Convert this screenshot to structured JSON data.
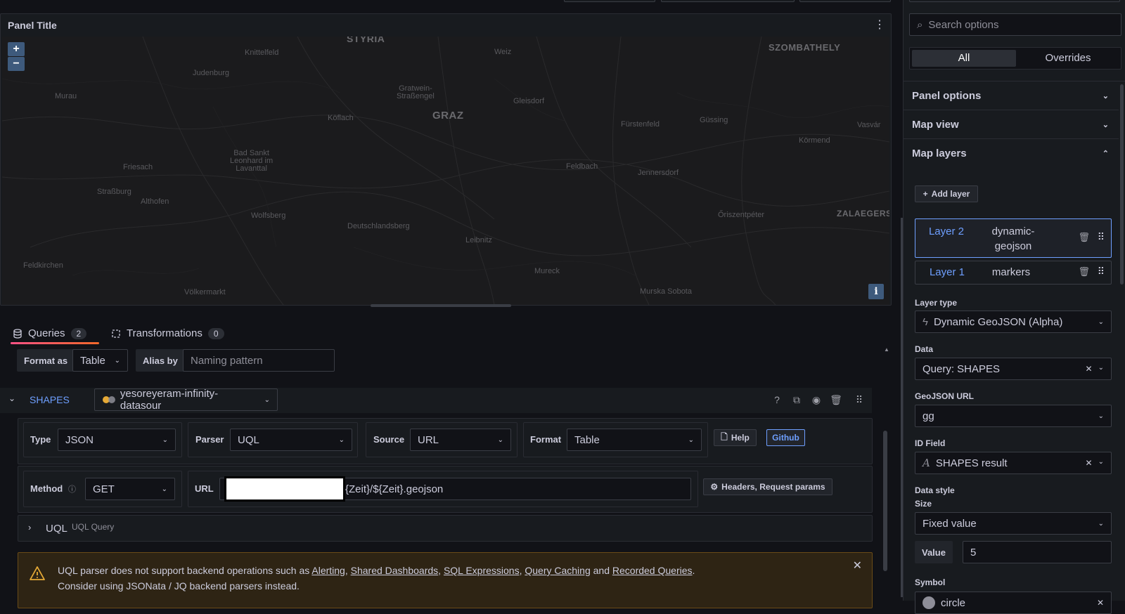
{
  "panel": {
    "title": "Panel Title",
    "menu_glyph": "⋮",
    "zoom_in": "+",
    "zoom_out": "−",
    "info_glyph": "i",
    "map_labels": {
      "styria": "STYRIA",
      "szombathely": "SZOMBATHELY",
      "knittelfeld": "Knittelfeld",
      "weiz": "Weiz",
      "judenburg": "Judenburg",
      "murau": "Murau",
      "gratwein": "Gratwein-\nStraßengel",
      "gleisdorf": "Gleisdorf",
      "graz": "GRAZ",
      "koflach": "Köflach",
      "furstenfeld": "Fürstenfeld",
      "gussing": "Güssing",
      "vasvar": "Vasvár",
      "kormend": "Körmend",
      "badsankt": "Bad Sankt\nLeonhard im\nLavanttal",
      "friesach": "Friesach",
      "feldbach": "Feldbach",
      "jennersdorf": "Jennersdorf",
      "strassburg": "Straßburg",
      "althofen": "Althofen",
      "wolfsberg": "Wolfsberg",
      "deutschlandsberg": "Deutschlandsberg",
      "oriszent": "Őriszentpéter",
      "zalaeg": "ZALAEGERSZ",
      "leibnitz": "Leibnitz",
      "feldkirchen": "Feldkirchen",
      "mureck": "Mureck",
      "volkermarkt": "Völkermarkt",
      "murska": "Murska Sobota"
    }
  },
  "tabs": {
    "queries_label": "Queries",
    "queries_count": "2",
    "transformations_label": "Transformations",
    "transformations_count": "0"
  },
  "query_options": {
    "format_as_label": "Format as",
    "format_as_value": "Table",
    "alias_by_label": "Alias by",
    "alias_placeholder": "Naming pattern"
  },
  "query": {
    "ref_id": "SHAPES",
    "datasource": "yesoreyeram-infinity-datasour",
    "type_label": "Type",
    "type_value": "JSON",
    "parser_label": "Parser",
    "parser_value": "UQL",
    "source_label": "Source",
    "source_value": "URL",
    "format_label": "Format",
    "format_value": "Table",
    "help_label": "Help",
    "github_label": "Github",
    "method_label": "Method",
    "method_value": "GET",
    "url_label": "URL",
    "url_value": "{Zeit}/${Zeit}.geojson",
    "headers_label": "Headers, Request params",
    "uql_title": "UQL",
    "uql_sub": "UQL Query"
  },
  "alert": {
    "line1_prefix": "UQL parser does not support backend operations such as ",
    "link_alerting": "Alerting",
    "sep1": ", ",
    "link_shared": "Shared Dashboards",
    "sep2": ", ",
    "link_sql": "SQL Expressions",
    "sep3": ", ",
    "link_caching": "Query Caching",
    "and_text": " and ",
    "link_recorded": "Recorded Queries",
    "end": ".",
    "line2": "Consider using JSONata / JQ backend parsers instead."
  },
  "options_pane": {
    "search_placeholder": "Search options",
    "tab_all": "All",
    "tab_overrides": "Overrides",
    "sections": {
      "panel_options": "Panel options",
      "map_view": "Map view",
      "map_layers": "Map layers"
    },
    "add_layer": "Add layer",
    "layers": [
      {
        "name": "Layer 2",
        "type": "dynamic-geojson"
      },
      {
        "name": "Layer 1",
        "type": "markers"
      }
    ],
    "layer_type_label": "Layer type",
    "layer_type_value": "Dynamic GeoJSON (Alpha)",
    "data_label": "Data",
    "data_value": "Query: SHAPES",
    "geojson_url_label": "GeoJSON URL",
    "geojson_url_value": "gg",
    "id_field_label": "ID Field",
    "id_field_value": "SHAPES result",
    "data_style_label": "Data style",
    "size_label": "Size",
    "size_value": "Fixed value",
    "value_label": "Value",
    "value_value": "5",
    "symbol_label": "Symbol",
    "symbol_value": "circle"
  },
  "colors": {
    "accent_blue": "#6e9fff",
    "tab_gradient_start": "#ff5286",
    "tab_gradient_end": "#f2682a",
    "alert_bg": "#2e2414",
    "warning_icon": "#e5a936"
  }
}
